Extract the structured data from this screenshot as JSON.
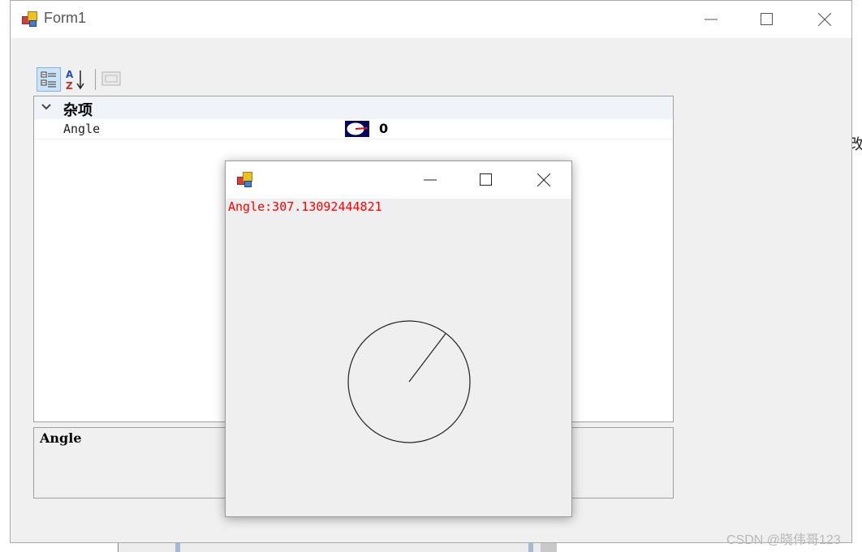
{
  "background": {
    "edge_char": "改"
  },
  "form1": {
    "title": "Form1",
    "property_grid": {
      "category": "杂项",
      "property_name": "Angle",
      "property_value": "0",
      "description_title": "Angle"
    }
  },
  "dialog": {
    "title": "",
    "angle_label": "Angle:307.13092444821",
    "angle": 307.13092444821
  },
  "watermark": "CSDN @晓伟哥123",
  "colors": {
    "angle_text": "#ff0000",
    "value_icon_bg": "#000060",
    "toolbar_selected": "#cce4f7"
  }
}
